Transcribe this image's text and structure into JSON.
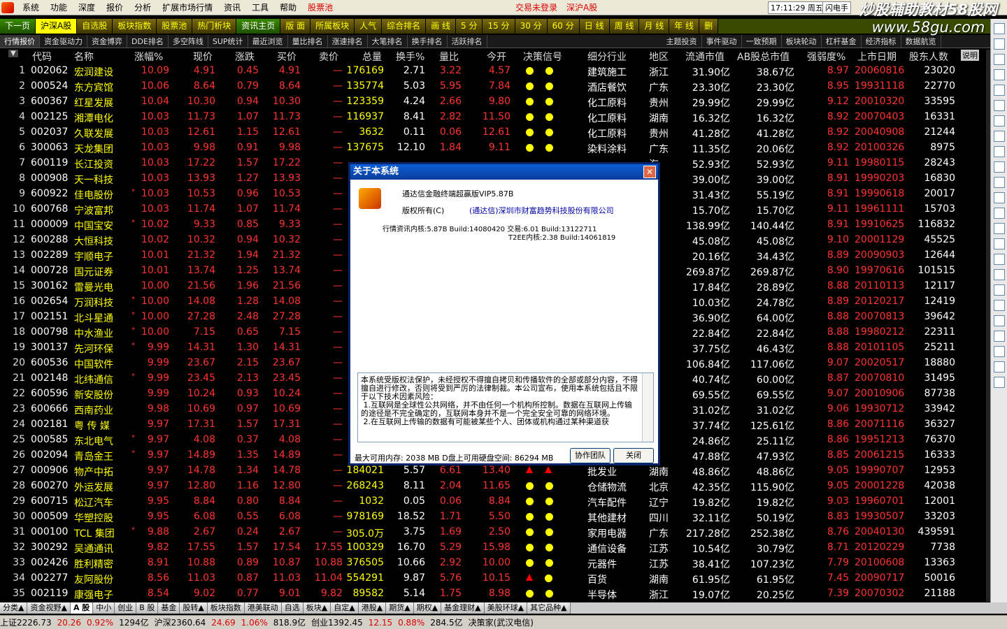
{
  "menubar": {
    "items": [
      "系统",
      "功能",
      "深度",
      "报价",
      "分析",
      "扩展市场行情",
      "资讯",
      "工具",
      "帮助"
    ],
    "stock_pool": "股票池",
    "trade_status": "交易未登录",
    "market": "深沪A股",
    "clock": "17:11:29 周五",
    "right_label": "闪电手"
  },
  "watermark": {
    "line1": "炒股辅助教材58股网",
    "line2": "www.58gu.com"
  },
  "toolbar": {
    "items": [
      "下一页",
      "沪深A股",
      "自选股",
      "板块指数",
      "股票池",
      "热门析块",
      "资讯主页",
      "版 面",
      "所属板块",
      "人气",
      "综合排名",
      "画 线",
      "5 分",
      "15 分",
      "30 分",
      "60 分",
      "日 线",
      "周 线",
      "月 线",
      "年 线",
      "删"
    ]
  },
  "subtabs": {
    "items": [
      "行情报价",
      "资金驱动力",
      "资金博弈",
      "DDE排名",
      "多空阵线",
      "SUP统计",
      "最近浏览",
      "量比排名",
      "涨速排名",
      "大笔排名",
      "换手排名",
      "活跃排名",
      "主题投资",
      "事件驱动",
      "一致预期",
      "板块轮动",
      "杠杆基金",
      "经济指标",
      "数据航览"
    ]
  },
  "columns": {
    "idx_toggle": "▼",
    "code": "代码",
    "name": "名称",
    "chg": "涨幅%",
    "price": "现价",
    "up": "涨跌",
    "bid": "买价",
    "ask": "卖价",
    "vol": "总量",
    "turn": "换手%",
    "ratio": "量比",
    "open": "今开",
    "sig": "决策信号",
    "ind": "细分行业",
    "reg": "地区",
    "float": "流通市值",
    "ab": "AB股总市值",
    "str": "强弱度%",
    "date": "上市日期",
    "hold": "股东人数",
    "note": "说明"
  },
  "rows": [
    {
      "i": "1",
      "code": "002062",
      "name": "宏润建设",
      "star": "",
      "chg": "10.09",
      "price": "4.91",
      "up": "0.45",
      "bid": "4.91",
      "ask": "—",
      "vol": "176169",
      "turn": "2.71",
      "ratio": "3.22",
      "open": "4.57",
      "sig": "dd",
      "ind": "建筑施工",
      "reg": "浙江",
      "float": "31.90亿",
      "ab": "38.67亿",
      "str": "8.97",
      "date": "20060816",
      "hold": "23020"
    },
    {
      "i": "2",
      "code": "000524",
      "name": "东方宾馆",
      "star": "",
      "chg": "10.06",
      "price": "8.64",
      "up": "0.79",
      "bid": "8.64",
      "ask": "—",
      "vol": "135774",
      "turn": "5.03",
      "ratio": "5.95",
      "open": "7.84",
      "sig": "dd",
      "ind": "酒店餐饮",
      "reg": "广东",
      "float": "23.30亿",
      "ab": "23.30亿",
      "str": "8.95",
      "date": "19931118",
      "hold": "22770"
    },
    {
      "i": "3",
      "code": "600367",
      "name": "红星发展",
      "star": "",
      "chg": "10.04",
      "price": "10.30",
      "up": "0.94",
      "bid": "10.30",
      "ask": "—",
      "vol": "123359",
      "turn": "4.24",
      "ratio": "2.66",
      "open": "9.80",
      "sig": "dd",
      "ind": "化工原料",
      "reg": "贵州",
      "float": "29.99亿",
      "ab": "29.99亿",
      "str": "9.12",
      "date": "20010320",
      "hold": "33595"
    },
    {
      "i": "4",
      "code": "002125",
      "name": "湘潭电化",
      "star": "",
      "chg": "10.03",
      "price": "11.73",
      "up": "1.07",
      "bid": "11.73",
      "ask": "—",
      "vol": "116937",
      "turn": "8.41",
      "ratio": "2.82",
      "open": "11.50",
      "sig": "dd",
      "ind": "化工原料",
      "reg": "湖南",
      "float": "16.32亿",
      "ab": "16.32亿",
      "str": "8.92",
      "date": "20070403",
      "hold": "16331"
    },
    {
      "i": "5",
      "code": "002037",
      "name": "久联发展",
      "star": "",
      "chg": "10.03",
      "price": "12.61",
      "up": "1.15",
      "bid": "12.61",
      "ask": "—",
      "vol": "3632",
      "turn": "0.11",
      "ratio": "0.06",
      "open": "12.61",
      "sig": "dd",
      "ind": "化工原料",
      "reg": "贵州",
      "float": "41.28亿",
      "ab": "41.28亿",
      "str": "8.92",
      "date": "20040908",
      "hold": "21244"
    },
    {
      "i": "6",
      "code": "300063",
      "name": "天龙集团",
      "star": "",
      "chg": "10.03",
      "price": "9.98",
      "up": "0.91",
      "bid": "9.98",
      "ask": "—",
      "vol": "137675",
      "turn": "12.10",
      "ratio": "1.84",
      "open": "9.11",
      "sig": "dd",
      "ind": "染料涂料",
      "reg": "广东",
      "float": "11.35亿",
      "ab": "20.06亿",
      "str": "8.92",
      "date": "20100326",
      "hold": "8975"
    },
    {
      "i": "7",
      "code": "600119",
      "name": "长江投资",
      "star": "",
      "chg": "10.03",
      "price": "17.22",
      "up": "1.57",
      "bid": "17.22",
      "ask": "—",
      "vol": "",
      "turn": "",
      "ratio": "",
      "open": "",
      "sig": "",
      "ind": "",
      "reg": "海",
      "float": "52.93亿",
      "ab": "52.93亿",
      "str": "9.11",
      "date": "19980115",
      "hold": "28243"
    },
    {
      "i": "8",
      "code": "000908",
      "name": "天一科技",
      "star": "",
      "chg": "10.03",
      "price": "13.93",
      "up": "1.27",
      "bid": "13.93",
      "ask": "—",
      "vol": "",
      "turn": "",
      "ratio": "",
      "open": "",
      "sig": "",
      "ind": "",
      "reg": "南",
      "float": "39.00亿",
      "ab": "39.00亿",
      "str": "8.91",
      "date": "19990203",
      "hold": "16830"
    },
    {
      "i": "9",
      "code": "600922",
      "name": "佳电股份",
      "star": "*",
      "chg": "10.03",
      "price": "10.53",
      "up": "0.96",
      "bid": "10.53",
      "ask": "—",
      "vol": "",
      "turn": "",
      "ratio": "",
      "open": "",
      "sig": "",
      "ind": "",
      "reg": "江",
      "float": "31.43亿",
      "ab": "55.19亿",
      "str": "8.91",
      "date": "19990618",
      "hold": "20017"
    },
    {
      "i": "10",
      "code": "600768",
      "name": "宁波富邦",
      "star": "",
      "chg": "10.03",
      "price": "11.74",
      "up": "1.07",
      "bid": "11.74",
      "ask": "—",
      "vol": "",
      "turn": "",
      "ratio": "",
      "open": "",
      "sig": "",
      "ind": "",
      "reg": "江",
      "float": "15.70亿",
      "ab": "15.70亿",
      "str": "9.11",
      "date": "19961111",
      "hold": "15703"
    },
    {
      "i": "11",
      "code": "000009",
      "name": "中国宝安",
      "star": "*",
      "chg": "10.02",
      "price": "9.33",
      "up": "0.85",
      "bid": "9.33",
      "ask": "—",
      "vol": "",
      "turn": "",
      "ratio": "",
      "open": "",
      "sig": "",
      "ind": "",
      "reg": "圳",
      "float": "138.99亿",
      "ab": "140.44亿",
      "str": "8.91",
      "date": "19910625",
      "hold": "116832"
    },
    {
      "i": "12",
      "code": "600288",
      "name": "大恒科技",
      "star": "",
      "chg": "10.02",
      "price": "10.32",
      "up": "0.94",
      "bid": "10.32",
      "ask": "—",
      "vol": "",
      "turn": "",
      "ratio": "",
      "open": "",
      "sig": "",
      "ind": "",
      "reg": "京",
      "float": "45.08亿",
      "ab": "45.08亿",
      "str": "9.10",
      "date": "20001129",
      "hold": "45525"
    },
    {
      "i": "13",
      "code": "002289",
      "name": "宇顺电子",
      "star": "",
      "chg": "10.01",
      "price": "21.32",
      "up": "1.94",
      "bid": "21.32",
      "ask": "—",
      "vol": "",
      "turn": "",
      "ratio": "",
      "open": "",
      "sig": "",
      "ind": "",
      "reg": "圳",
      "float": "20.16亿",
      "ab": "34.43亿",
      "str": "8.89",
      "date": "20090903",
      "hold": "12644"
    },
    {
      "i": "14",
      "code": "000728",
      "name": "国元证券",
      "star": "",
      "chg": "10.01",
      "price": "13.74",
      "up": "1.25",
      "bid": "13.74",
      "ask": "—",
      "vol": "",
      "turn": "",
      "ratio": "",
      "open": "",
      "sig": "",
      "ind": "",
      "reg": "徽",
      "float": "269.87亿",
      "ab": "269.87亿",
      "str": "8.90",
      "date": "19970616",
      "hold": "101515"
    },
    {
      "i": "15",
      "code": "300162",
      "name": "雷曼光电",
      "star": "",
      "chg": "10.00",
      "price": "21.56",
      "up": "1.96",
      "bid": "21.56",
      "ask": "—",
      "vol": "",
      "turn": "",
      "ratio": "",
      "open": "",
      "sig": "",
      "ind": "",
      "reg": "圳",
      "float": "17.84亿",
      "ab": "28.89亿",
      "str": "8.88",
      "date": "20110113",
      "hold": "12117"
    },
    {
      "i": "16",
      "code": "002654",
      "name": "万润科技",
      "star": "*",
      "chg": "10.00",
      "price": "14.08",
      "up": "1.28",
      "bid": "14.08",
      "ask": "—",
      "vol": "",
      "turn": "",
      "ratio": "",
      "open": "",
      "sig": "",
      "ind": "",
      "reg": "圳",
      "float": "10.03亿",
      "ab": "24.78亿",
      "str": "8.89",
      "date": "20120217",
      "hold": "12419"
    },
    {
      "i": "17",
      "code": "002151",
      "name": "北斗星通",
      "star": "*",
      "chg": "10.00",
      "price": "27.28",
      "up": "2.48",
      "bid": "27.28",
      "ask": "—",
      "vol": "",
      "turn": "",
      "ratio": "",
      "open": "",
      "sig": "",
      "ind": "",
      "reg": "京",
      "float": "36.90亿",
      "ab": "64.00亿",
      "str": "8.88",
      "date": "20070813",
      "hold": "39642"
    },
    {
      "i": "18",
      "code": "000798",
      "name": "中水渔业",
      "star": "*",
      "chg": "10.00",
      "price": "7.15",
      "up": "0.65",
      "bid": "7.15",
      "ask": "—",
      "vol": "",
      "turn": "",
      "ratio": "",
      "open": "",
      "sig": "",
      "ind": "",
      "reg": "京",
      "float": "22.84亿",
      "ab": "22.84亿",
      "str": "8.88",
      "date": "19980212",
      "hold": "22311"
    },
    {
      "i": "19",
      "code": "300137",
      "name": "先河环保",
      "star": "*",
      "chg": "9.99",
      "price": "14.31",
      "up": "1.30",
      "bid": "14.31",
      "ask": "—",
      "vol": "",
      "turn": "",
      "ratio": "",
      "open": "",
      "sig": "",
      "ind": "",
      "reg": "北",
      "float": "37.75亿",
      "ab": "46.43亿",
      "str": "8.88",
      "date": "20101105",
      "hold": "25211"
    },
    {
      "i": "20",
      "code": "600536",
      "name": "中国软件",
      "star": "",
      "chg": "9.99",
      "price": "23.67",
      "up": "2.15",
      "bid": "23.67",
      "ask": "—",
      "vol": "",
      "turn": "",
      "ratio": "",
      "open": "",
      "sig": "",
      "ind": "",
      "reg": "京",
      "float": "106.84亿",
      "ab": "117.06亿",
      "str": "9.07",
      "date": "20020517",
      "hold": "18880"
    },
    {
      "i": "21",
      "code": "002148",
      "name": "北纬通信",
      "star": "*",
      "chg": "9.99",
      "price": "23.45",
      "up": "2.13",
      "bid": "23.45",
      "ask": "—",
      "vol": "",
      "turn": "",
      "ratio": "",
      "open": "",
      "sig": "",
      "ind": "",
      "reg": "京",
      "float": "40.74亿",
      "ab": "60.00亿",
      "str": "8.87",
      "date": "20070810",
      "hold": "31495"
    },
    {
      "i": "22",
      "code": "600596",
      "name": "新安股份",
      "star": "",
      "chg": "9.99",
      "price": "10.24",
      "up": "0.93",
      "bid": "10.24",
      "ask": "—",
      "vol": "",
      "turn": "",
      "ratio": "",
      "open": "",
      "sig": "",
      "ind": "",
      "reg": "江",
      "float": "69.55亿",
      "ab": "69.55亿",
      "str": "9.07",
      "date": "20010906",
      "hold": "87738"
    },
    {
      "i": "23",
      "code": "600666",
      "name": "西南药业",
      "star": "",
      "chg": "9.98",
      "price": "10.69",
      "up": "0.97",
      "bid": "10.69",
      "ask": "—",
      "vol": "",
      "turn": "",
      "ratio": "",
      "open": "",
      "sig": "",
      "ind": "",
      "reg": "庆",
      "float": "31.02亿",
      "ab": "31.02亿",
      "str": "9.06",
      "date": "19930712",
      "hold": "33942"
    },
    {
      "i": "24",
      "code": "002181",
      "name": "粤 传 媒",
      "star": "",
      "chg": "9.97",
      "price": "17.31",
      "up": "1.57",
      "bid": "17.31",
      "ask": "—",
      "vol": "",
      "turn": "",
      "ratio": "",
      "open": "",
      "sig": "",
      "ind": "",
      "reg": "东",
      "float": "37.74亿",
      "ab": "125.61亿",
      "str": "8.86",
      "date": "20071116",
      "hold": "36327"
    },
    {
      "i": "25",
      "code": "000585",
      "name": "东北电气",
      "star": "*",
      "chg": "9.97",
      "price": "4.08",
      "up": "0.37",
      "bid": "4.08",
      "ask": "—",
      "vol": "",
      "turn": "",
      "ratio": "",
      "open": "",
      "sig": "",
      "ind": "",
      "reg": "宁",
      "float": "24.86亿",
      "ab": "25.11亿",
      "str": "8.86",
      "date": "19951213",
      "hold": "76370"
    },
    {
      "i": "26",
      "code": "002094",
      "name": "青岛金王",
      "star": "*",
      "chg": "9.97",
      "price": "14.89",
      "up": "1.35",
      "bid": "14.89",
      "ask": "—",
      "vol": "",
      "turn": "",
      "ratio": "",
      "open": "",
      "sig": "",
      "ind": "",
      "reg": "东",
      "float": "47.88亿",
      "ab": "47.93亿",
      "str": "8.85",
      "date": "20061215",
      "hold": "16333"
    },
    {
      "i": "27",
      "code": "000906",
      "name": "物产中拓",
      "star": "",
      "chg": "9.97",
      "price": "14.78",
      "up": "1.34",
      "bid": "14.78",
      "ask": "—",
      "vol": "184021",
      "turn": "5.57",
      "ratio": "6.61",
      "open": "13.40",
      "sig": "tt",
      "ind": "批发业",
      "reg": "湖南",
      "float": "48.86亿",
      "ab": "48.86亿",
      "str": "9.05",
      "date": "19990707",
      "hold": "12953"
    },
    {
      "i": "28",
      "code": "600270",
      "name": "外运发展",
      "star": "",
      "chg": "9.97",
      "price": "12.80",
      "up": "1.16",
      "bid": "12.80",
      "ask": "—",
      "vol": "268243",
      "turn": "8.11",
      "ratio": "2.04",
      "open": "11.65",
      "sig": "dd",
      "ind": "仓储物流",
      "reg": "北京",
      "float": "42.35亿",
      "ab": "115.90亿",
      "str": "9.05",
      "date": "20001228",
      "hold": "42038"
    },
    {
      "i": "29",
      "code": "600715",
      "name": "松辽汽车",
      "star": "",
      "chg": "9.95",
      "price": "8.84",
      "up": "0.80",
      "bid": "8.84",
      "ask": "—",
      "vol": "1032",
      "turn": "0.05",
      "ratio": "0.06",
      "open": "8.84",
      "sig": "dd",
      "ind": "汽车配件",
      "reg": "辽宁",
      "float": "19.82亿",
      "ab": "19.82亿",
      "str": "9.03",
      "date": "19960701",
      "hold": "12001"
    },
    {
      "i": "30",
      "code": "000509",
      "name": "华塑控股",
      "star": "",
      "chg": "9.95",
      "price": "6.08",
      "up": "0.55",
      "bid": "6.08",
      "ask": "—",
      "vol": "978169",
      "turn": "18.52",
      "ratio": "1.71",
      "open": "5.50",
      "sig": "dd",
      "ind": "其他建材",
      "reg": "四川",
      "float": "32.11亿",
      "ab": "50.19亿",
      "str": "8.83",
      "date": "19930507",
      "hold": "33203"
    },
    {
      "i": "31",
      "code": "000100",
      "name": "TCL 集团",
      "star": "*",
      "chg": "9.88",
      "price": "2.67",
      "up": "0.24",
      "bid": "2.67",
      "ask": "—",
      "vol": "305.0万",
      "turn": "3.75",
      "ratio": "1.69",
      "open": "2.50",
      "sig": "dd",
      "ind": "家用电器",
      "reg": "广东",
      "float": "217.28亿",
      "ab": "252.38亿",
      "str": "8.76",
      "date": "20040130",
      "hold": "439591"
    },
    {
      "i": "32",
      "code": "300292",
      "name": "吴通通讯",
      "star": "",
      "chg": "9.82",
      "price": "17.55",
      "up": "1.57",
      "bid": "17.54",
      "ask": "17.55",
      "vol": "100329",
      "turn": "16.70",
      "ratio": "5.29",
      "open": "15.98",
      "sig": "dd",
      "ind": "通信设备",
      "reg": "江苏",
      "float": "10.54亿",
      "ab": "30.79亿",
      "str": "8.71",
      "date": "20120229",
      "hold": "7738"
    },
    {
      "i": "33",
      "code": "002426",
      "name": "胜利精密",
      "star": "",
      "chg": "8.91",
      "price": "10.88",
      "up": "0.89",
      "bid": "10.87",
      "ask": "10.88",
      "vol": "376505",
      "turn": "10.66",
      "ratio": "2.92",
      "open": "10.00",
      "sig": "dd",
      "ind": "元器件",
      "reg": "江苏",
      "float": "38.41亿",
      "ab": "107.23亿",
      "str": "7.79",
      "date": "20100608",
      "hold": "13363"
    },
    {
      "i": "34",
      "code": "002277",
      "name": "友阿股份",
      "star": "",
      "chg": "8.56",
      "price": "11.03",
      "up": "0.87",
      "bid": "11.03",
      "ask": "11.04",
      "vol": "554291",
      "turn": "9.87",
      "ratio": "5.76",
      "open": "10.15",
      "sig": "td",
      "ind": "百货",
      "reg": "湖南",
      "float": "61.95亿",
      "ab": "61.95亿",
      "str": "7.45",
      "date": "20090717",
      "hold": "50016"
    },
    {
      "i": "35",
      "code": "002119",
      "name": "康强电子",
      "star": "",
      "chg": "8.54",
      "price": "9.02",
      "up": "0.77",
      "bid": "9.01",
      "ask": "9.82",
      "vol": "89582",
      "turn": "5.14",
      "ratio": "1.75",
      "open": "8.98",
      "sig": "dd",
      "ind": "半导体",
      "reg": "浙江",
      "float": "19.07亿",
      "ab": "20.25亿",
      "str": "7.39",
      "date": "20070302",
      "hold": "21188"
    }
  ],
  "bottomtabs": [
    "分类▲",
    "资金视野▲",
    "A 股",
    "中小",
    "创业",
    "B 股",
    "基金",
    "股转▲",
    "板块指数",
    "港美联动",
    "自选",
    "板块▲",
    "自定▲",
    "港股▲",
    "期货▲",
    "期权▲",
    "基金理财▲",
    "美股环球▲",
    "其它品种▲"
  ],
  "statusbar": {
    "sh_label": "上证2226.73",
    "sh_chg": "20.26",
    "sh_pct": "0.92%",
    "sh_amt": "1294亿",
    "hs_label": "沪深2360.64",
    "hs_chg": "24.69",
    "hs_pct": "1.06%",
    "hs_amt": "818.9亿",
    "cy_label": "创业1392.45",
    "cy_chg": "12.15",
    "cy_pct": "0.88%",
    "cy_amt": "284.5亿",
    "broker": "决策家(武汉电信)"
  },
  "dialog": {
    "title": "关于本系统",
    "close": "✕",
    "product": "通达信金融终端超赢版VIP5.87B",
    "copyright": "版权所有(C)",
    "company": "(通达信)深圳市财富趋势科技股份有限公司",
    "version1": "行情资讯内核:5.87B Build:14080420 交易:6.01 Build:13122711",
    "version2": "T2EE内核:2.38 Build:14061819",
    "legal": "本系统受版权法保护，未经授权不得擅自拷贝和传播软件的全部或部分内容，不得擅自进行修改，否则将受到严厉的法律制裁。本公司宣布，使用本系统包括且不限于以下技术因素风险：\n 1.互联网是全球性公共网络，并不由任何一个机构所控制。数据在互联网上传输的途径是不完全确定的，互联网本身并不是一个完全安全可靠的网络环境。\n 2.在互联网上传输的数据有可能被某些个人、团体或机构通过某种渠道获",
    "memory": "最大可用内存: 2038 MB   D盘上可用硬盘空间: 86294 MB",
    "team_button": "协作团队",
    "close_button": "关闭"
  },
  "colors": {
    "rise": "#ff3333",
    "highlight": "#ffff00",
    "title_bar": "#0a246a"
  }
}
